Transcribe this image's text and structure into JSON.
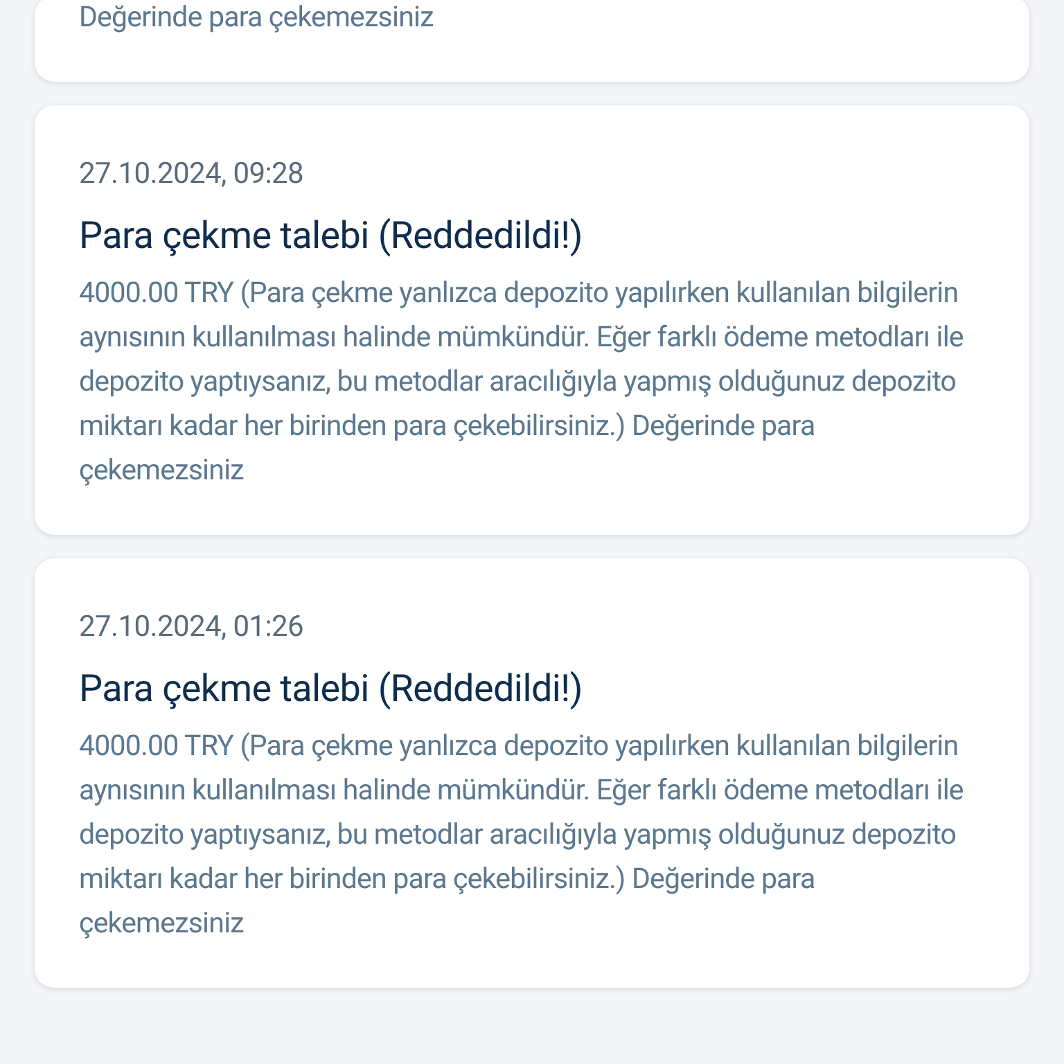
{
  "notifications": [
    {
      "body": "Değerinde para çekemezsiniz"
    },
    {
      "date": "27.10.2024, 09:28",
      "title": "Para çekme talebi (Reddedildi!)",
      "body": "4000.00 TRY (Para çekme yanlızca depozito yapılırken kullanılan bilgilerin aynısının kullanılması halinde mümkündür. Eğer farklı ödeme metodları ile depozito yaptıysanız, bu metodlar aracılığıyla yapmış olduğunuz depozito miktarı kadar her birinden para çekebilirsiniz.) Değerinde para çekemezsiniz"
    },
    {
      "date": "27.10.2024, 01:26",
      "title": "Para çekme talebi (Reddedildi!)",
      "body": "4000.00 TRY (Para çekme yanlızca depozito yapılırken kullanılan bilgilerin aynısının kullanılması halinde mümkündür. Eğer farklı ödeme metodları ile depozito yaptıysanız, bu metodlar aracılığıyla yapmış olduğunuz depozito miktarı kadar her birinden para çekebilirsiniz.) Değerinde para çekemezsiniz"
    }
  ]
}
